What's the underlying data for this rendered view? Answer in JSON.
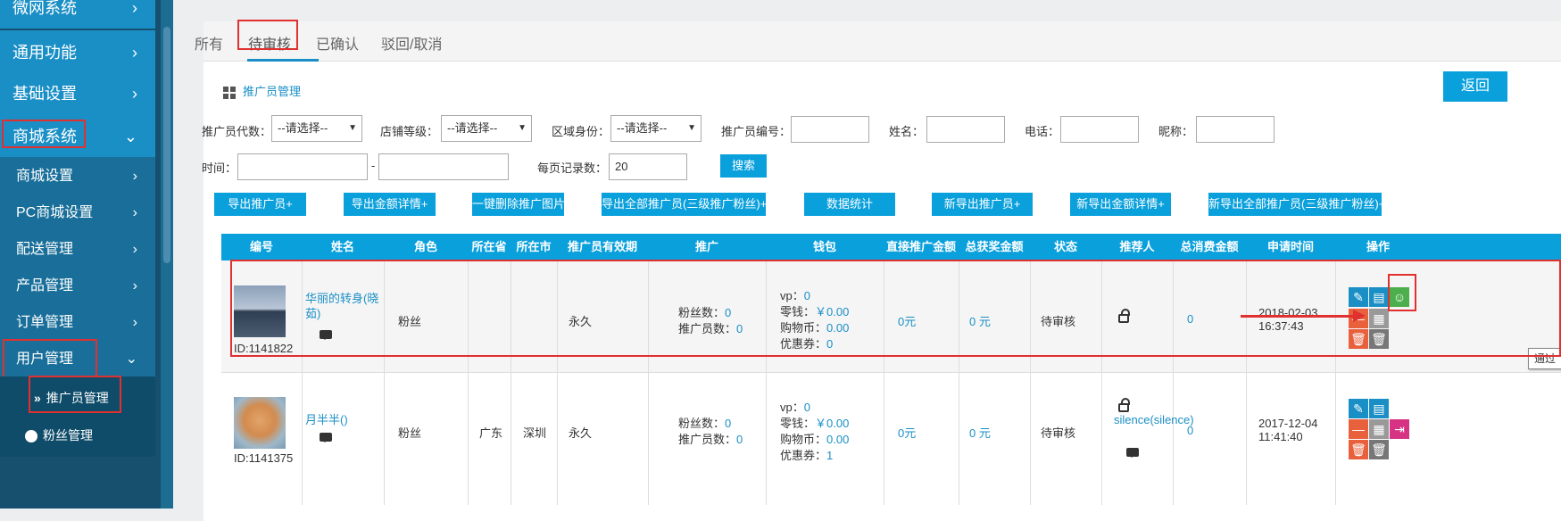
{
  "sidebar": {
    "items": [
      {
        "label": "微网系统",
        "chevron": "›"
      },
      {
        "label": "通用功能",
        "chevron": "›"
      },
      {
        "label": "基础设置",
        "chevron": "›"
      },
      {
        "label": "商城系统",
        "chevron": "⌄"
      }
    ],
    "subitems": [
      {
        "label": "商城设置",
        "chevron": "›"
      },
      {
        "label": "PC商城设置",
        "chevron": "›"
      },
      {
        "label": "配送管理",
        "chevron": "›"
      },
      {
        "label": "产品管理",
        "chevron": "›"
      },
      {
        "label": "订单管理",
        "chevron": "›"
      },
      {
        "label": "用户管理",
        "chevron": "⌄"
      }
    ],
    "leaves": [
      {
        "label": "推广员管理",
        "icon": "double-chevron-icon"
      },
      {
        "label": "粉丝管理",
        "icon": "user-circle-icon"
      }
    ]
  },
  "tabs": [
    "所有",
    "待审核",
    "已确认",
    "驳回/取消"
  ],
  "breadcrumb": "推广员管理",
  "back_button": "返回",
  "filters": {
    "level_label": "推广员代数：",
    "level_value": "--请选择--",
    "shop_label": "店铺等级：",
    "shop_value": "--请选择--",
    "region_label": "区域身份：",
    "region_value": "--请选择--",
    "code_label": "推广员编号：",
    "name_label": "姓名：",
    "phone_label": "电话：",
    "nick_label": "昵称：",
    "time_label": "时间：",
    "time_sep": "-",
    "perpage_label": "每页记录数：",
    "perpage_value": "20",
    "search_button": "搜索"
  },
  "actions": [
    "导出推广员+",
    "导出金额详情+",
    "一键删除推广图片",
    "导出全部推广员(三级推广粉丝)+",
    "数据统计",
    "新导出推广员+",
    "新导出金额详情+",
    "新导出全部推广员(三级推广粉丝)+"
  ],
  "table": {
    "headers": [
      "编号",
      "姓名",
      "角色",
      "所在省",
      "所在市",
      "推广员有效期",
      "推广",
      "钱包",
      "直接推广金额",
      "总获奖金额",
      "状态",
      "推荐人",
      "总消费金额",
      "申请时间",
      "操作"
    ],
    "rows": [
      {
        "id": "ID:1141822",
        "name": "华丽的转身(晓茹)",
        "role": "粉丝",
        "province": "",
        "city": "",
        "validity": "永久",
        "fans_label": "粉丝数：",
        "fans": "0",
        "promoters_label": "推广员数：",
        "promoters": "0",
        "vp_label": "vp：",
        "vp": "0",
        "change_label": "零钱：",
        "change": "￥0.00",
        "coin_label": "购物币：",
        "coin": "0.00",
        "coupon_label": "优惠券：",
        "coupon": "0",
        "direct": "0元",
        "total": "0 元",
        "status": "待审核",
        "referrer": "",
        "consume": "0",
        "date": "2018-02-03",
        "time": "16:37:43"
      },
      {
        "id": "ID:1141375",
        "name": "月半半()",
        "role": "粉丝",
        "province": "广东",
        "city": "深圳",
        "validity": "永久",
        "fans_label": "粉丝数：",
        "fans": "0",
        "promoters_label": "推广员数：",
        "promoters": "0",
        "vp_label": "vp：",
        "vp": "0",
        "change_label": "零钱：",
        "change": "￥0.00",
        "coin_label": "购物币：",
        "coin": "0.00",
        "coupon_label": "优惠券：",
        "coupon": "1",
        "direct": "0元",
        "total": "0 元",
        "status": "待审核",
        "referrer": "silence(silence)",
        "consume": "0",
        "date": "2017-12-04",
        "time": "11:41:40"
      }
    ]
  },
  "tooltip": "通过",
  "colors": {
    "accent": "#0aa0dc",
    "highlight": "#e03030",
    "sidebar": "#16506e"
  }
}
